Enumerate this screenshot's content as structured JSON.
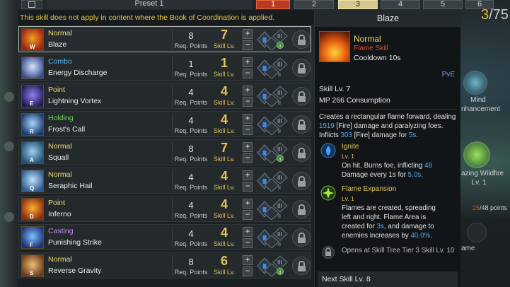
{
  "tabs": {
    "preset_name": "Preset 1",
    "numbers": [
      "1",
      "2",
      "3",
      "4",
      "5",
      "6"
    ],
    "active_index": 0,
    "selected_index": 2
  },
  "top_right": {
    "current": "3",
    "rest": "/75"
  },
  "notice": "This skill does not apply in content where the Book of Coordination is applied.",
  "labels": {
    "req_points": "Req. Points",
    "skill_lv": "Skill Lv.",
    "plus": "+",
    "minus": "−"
  },
  "skills": [
    {
      "tag": "Normal",
      "tag_color": "#eadc76",
      "name": "Blaze",
      "key": "W",
      "points": "8",
      "level": "7",
      "icon": "blaze-icon",
      "c1": "#f0a020",
      "c2": "#a02010",
      "tripod_green": true,
      "selected": true
    },
    {
      "tag": "Combo",
      "tag_color": "#58b4f0",
      "name": "Energy Discharge",
      "key": "",
      "points": "1",
      "level": "1",
      "icon": "energy-discharge-icon",
      "c1": "#d8e6ff",
      "c2": "#3a4a8a",
      "tripod_green": false,
      "selected": false
    },
    {
      "tag": "Point",
      "tag_color": "#eadc76",
      "name": "Lightning Vortex",
      "key": "E",
      "points": "4",
      "level": "4",
      "icon": "lightning-vortex-icon",
      "c1": "#9080f0",
      "c2": "#201a50",
      "tripod_green": false,
      "selected": false
    },
    {
      "tag": "Holding",
      "tag_color": "#6fd35a",
      "name": "Frost's Call",
      "key": "R",
      "points": "4",
      "level": "4",
      "icon": "frosts-call-icon",
      "c1": "#a8d4ff",
      "c2": "#1a3a6a",
      "tripod_green": false,
      "selected": false
    },
    {
      "tag": "Normal",
      "tag_color": "#eadc76",
      "name": "Squall",
      "key": "A",
      "points": "8",
      "level": "7",
      "icon": "squall-icon",
      "c1": "#9ad0f5",
      "c2": "#24506e",
      "tripod_green": true,
      "selected": false
    },
    {
      "tag": "Normal",
      "tag_color": "#eadc76",
      "name": "Seraphic Hail",
      "key": "Q",
      "points": "4",
      "level": "4",
      "icon": "seraphic-hail-icon",
      "c1": "#bfe4ff",
      "c2": "#2e5a8a",
      "tripod_green": false,
      "selected": false
    },
    {
      "tag": "Point",
      "tag_color": "#eadc76",
      "name": "Inferno",
      "key": "D",
      "points": "4",
      "level": "4",
      "icon": "inferno-icon",
      "c1": "#ffb030",
      "c2": "#8a2a10",
      "tripod_green": false,
      "selected": false
    },
    {
      "tag": "Casting",
      "tag_color": "#c58df0",
      "name": "Punishing Strike",
      "key": "F",
      "points": "4",
      "level": "4",
      "icon": "punishing-strike-icon",
      "c1": "#7fc0ff",
      "c2": "#1a3070",
      "tripod_green": false,
      "selected": false
    },
    {
      "tag": "Normal",
      "tag_color": "#eadc76",
      "name": "Reverse Gravity",
      "key": "S",
      "points": "8",
      "level": "6",
      "icon": "reverse-gravity-icon",
      "c1": "#f0c070",
      "c2": "#6a3a20",
      "tripod_green": true,
      "selected": false
    }
  ],
  "background": {
    "mind_label_1": "Mind",
    "mind_label_2": "nhancement",
    "wildfire_label": "azing Wildfire",
    "wildfire_lv": "Lv. 1",
    "points_current": "26",
    "points_rest": "/48 points",
    "ame": "ame"
  },
  "tooltip": {
    "title": "Blaze",
    "type": "Normal",
    "kind": "Flame Skill",
    "cooldown": "Cooldown 10s",
    "mode": "PvE",
    "skill_lv": "Skill Lv. 7",
    "mp": "MP 266 Consumption",
    "desc_1": "Creates a rectangular flame forward, dealing",
    "desc_2a": "1519",
    "desc_2b": " [Fire] damage and paralyzing foes.",
    "desc_3a": "Inflicts ",
    "desc_3b": "303",
    "desc_3c": " [Fire] damage for ",
    "desc_3d": "5s",
    "desc_3e": ".",
    "tripods": [
      {
        "name": "Ignite",
        "lv": "Lv. 1",
        "l1a": "On hit, Burns foe, inflicting ",
        "l1b": "48",
        "l2a": "Damage every 1s for ",
        "l2b": "5.0s",
        "l2c": "."
      },
      {
        "name": "Flame Expansion",
        "lv": "Lv. 1",
        "l1": "Flames are created, spreading",
        "l2": "left and right. Flame Area is",
        "l3a": "created for ",
        "l3b": "3s",
        "l3c": ", and damage to",
        "l4a": "enemies increases by ",
        "l4b": "40.0%",
        "l4c": "."
      }
    ],
    "locked_text": "Opens at Skill Tree Tier 3 Skill Lv. 10",
    "next": "Next Skill Lv. 8"
  }
}
